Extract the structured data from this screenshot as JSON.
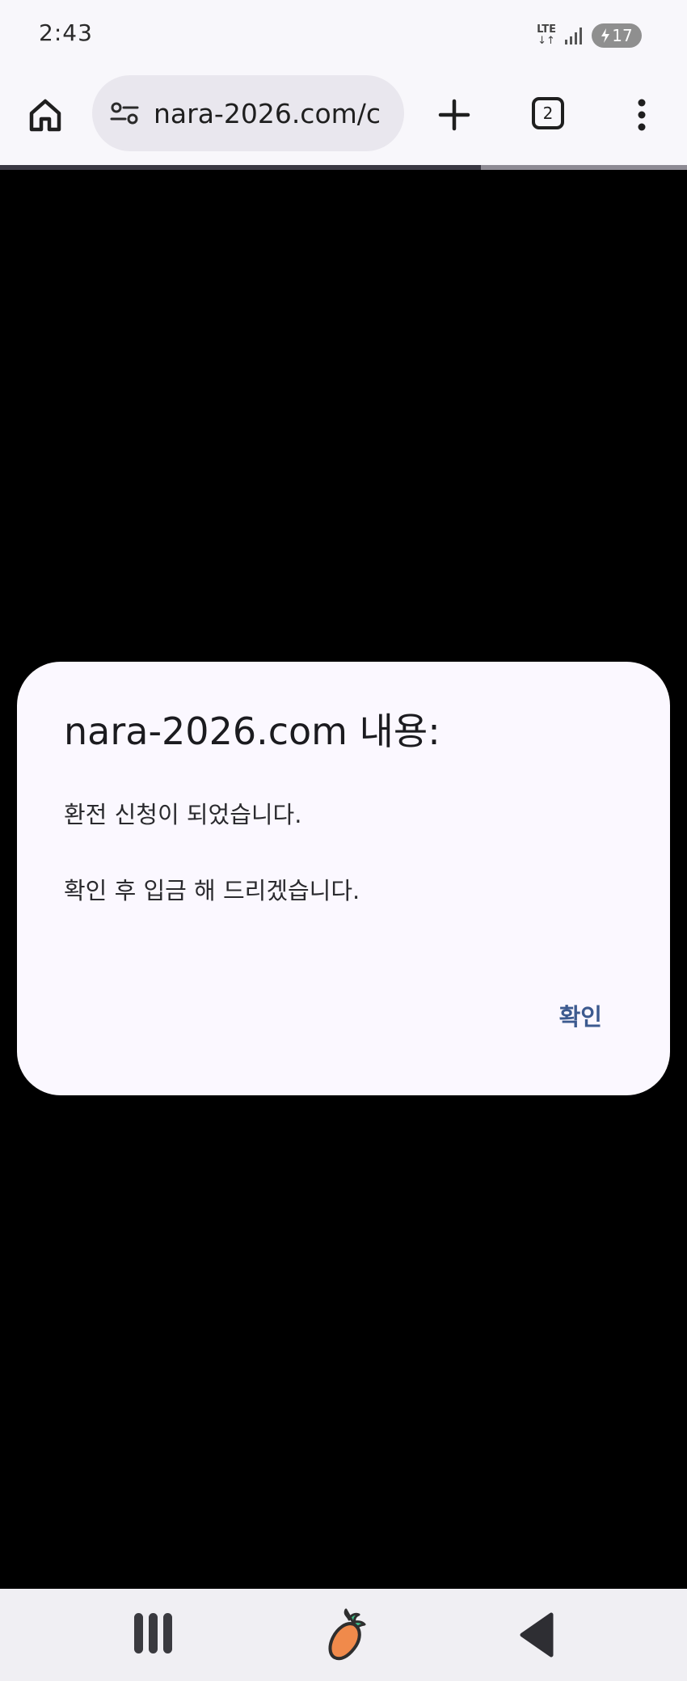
{
  "status_bar": {
    "time": "2:43",
    "network": "LTE",
    "network_arrows": "↓↑",
    "battery_level": "17"
  },
  "toolbar": {
    "url": "nara-2026.com/c",
    "tab_count": "2",
    "page_load_progress": 0.7
  },
  "dialog": {
    "title": "nara-2026.com 내용:",
    "message": "환전 신청이 되었습니다.\n\n확인 후 입금 해 드리겠습니다.",
    "ok_label": "확인"
  },
  "icons": {
    "home": "home-icon",
    "site_info": "site-settings-icon",
    "new_tab": "plus-icon",
    "menu": "more-vert-icon",
    "recents": "recent-apps-icon",
    "nav_home": "carrot-icon",
    "back": "back-triangle-icon"
  },
  "colors": {
    "dialog_background": "#fbf8ff",
    "dialog_button": "#3c5a8f",
    "page_background": "#000000",
    "toolbar_background": "#f8f7fb",
    "carrot_body": "#f08a4b",
    "carrot_leaf": "#3ec48b"
  }
}
